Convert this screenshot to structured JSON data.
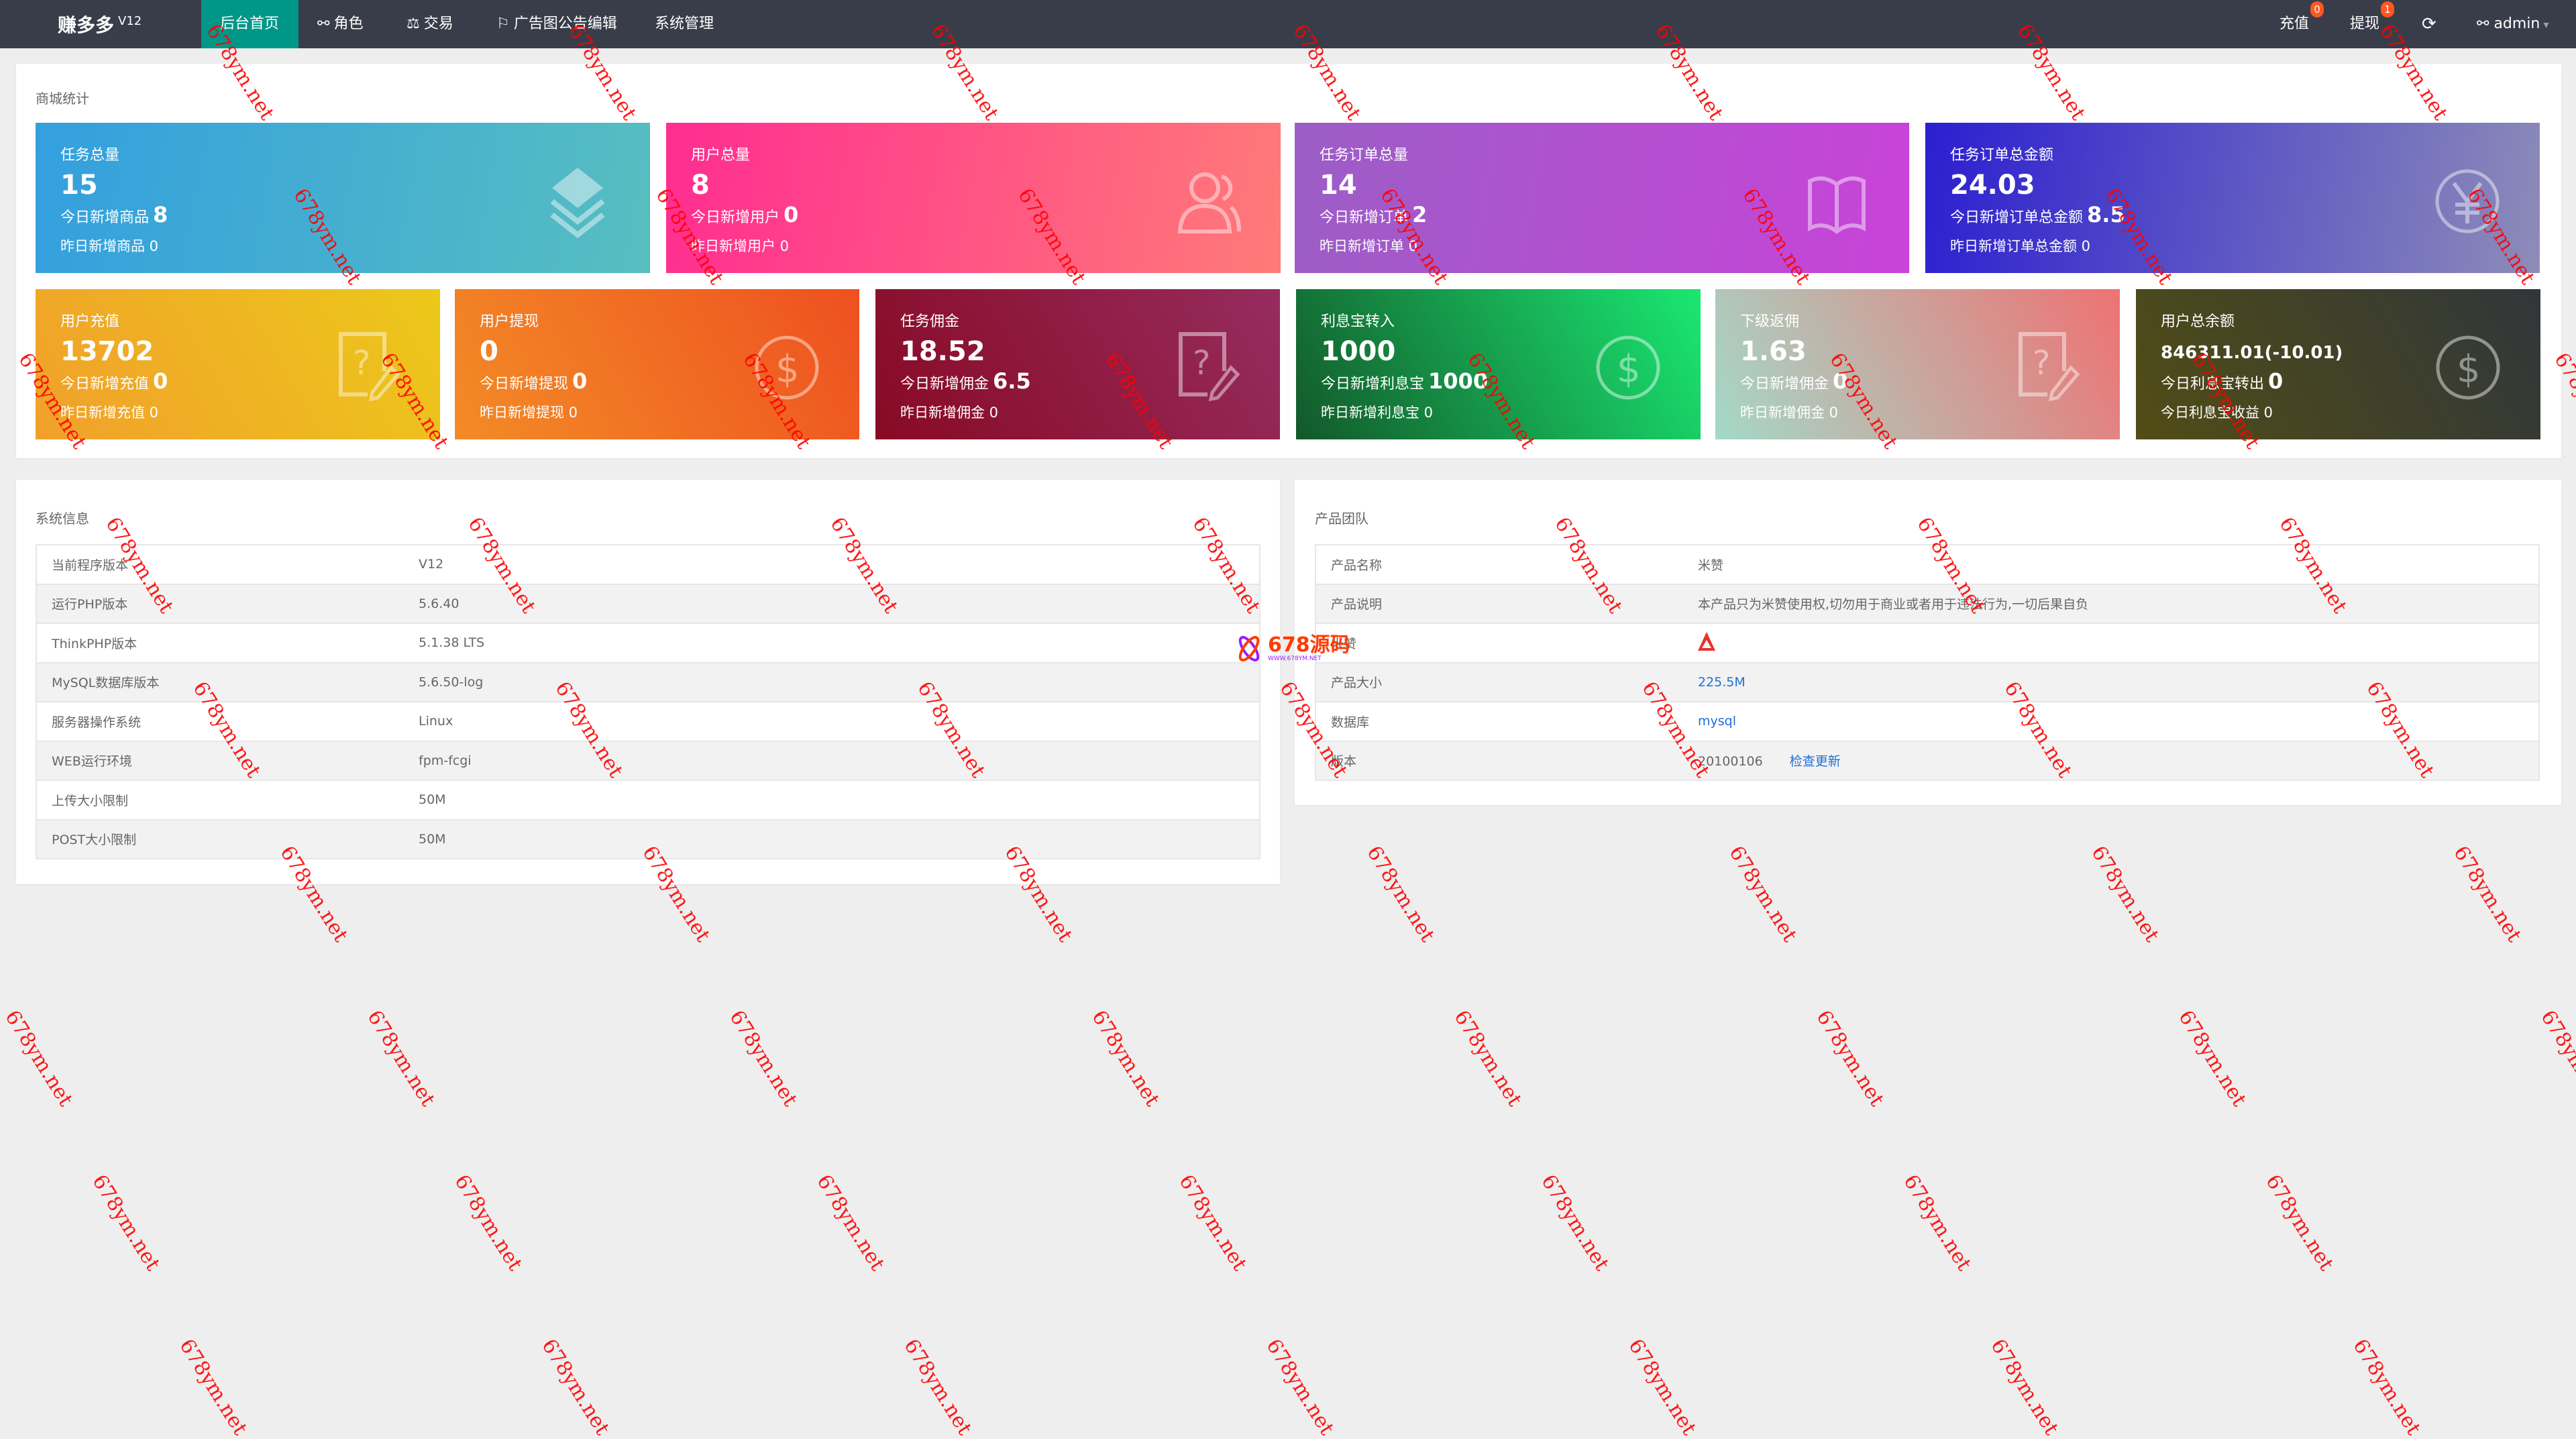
{
  "nav": {
    "logo": "赚多多",
    "version": "V12",
    "items": [
      {
        "label": "后台首页"
      },
      {
        "label": "角色"
      },
      {
        "label": "交易"
      },
      {
        "label": "广告图公告编辑"
      },
      {
        "label": "系统管理"
      }
    ],
    "recharge": "充值",
    "recharge_badge": "0",
    "withdraw": "提现",
    "withdraw_badge": "1",
    "user": "admin",
    "active_color": "#009688",
    "badge_color": "#ff5722"
  },
  "stats": {
    "title": "商城统计",
    "row1": [
      {
        "title": "任务总量",
        "value": "15",
        "l1": "今日新增商品",
        "l1v": "8",
        "l2": "昨日新增商品 0",
        "icon": "layers-icon"
      },
      {
        "title": "用户总量",
        "value": "8",
        "l1": "今日新增用户",
        "l1v": "0",
        "l2": "昨日新增用户 0",
        "icon": "users-icon"
      },
      {
        "title": "任务订单总量",
        "value": "14",
        "l1": "今日新增订单",
        "l1v": "2",
        "l2": "昨日新增订单 0",
        "icon": "book-icon"
      },
      {
        "title": "任务订单总金额",
        "value": "24.03",
        "l1": "今日新增订单总金额",
        "l1v": "8.5",
        "l2": "昨日新增订单总金额 0",
        "icon": "yen-icon"
      }
    ],
    "row2": [
      {
        "title": "用户充值",
        "value": "13702",
        "l1": "今日新增充值",
        "l1v": "0",
        "l2": "昨日新增充值 0",
        "icon": "help-edit-icon"
      },
      {
        "title": "用户提现",
        "value": "0",
        "l1": "今日新增提现",
        "l1v": "0",
        "l2": "昨日新增提现 0",
        "icon": "dollar-icon"
      },
      {
        "title": "任务佣金",
        "value": "18.52",
        "l1": "今日新增佣金",
        "l1v": "6.5",
        "l2": "昨日新增佣金 0",
        "icon": "help-edit-icon"
      },
      {
        "title": "利息宝转入",
        "value": "1000",
        "l1": "今日新增利息宝",
        "l1v": "1000",
        "l2": "昨日新增利息宝 0",
        "icon": "dollar-icon"
      },
      {
        "title": "下级返佣",
        "value": "1.63",
        "l1": "今日新增佣金",
        "l1v": "0",
        "l2": "昨日新增佣金 0",
        "icon": "help-edit-icon"
      },
      {
        "title": "用户总余额",
        "value": "846311.01(-10.01)",
        "l1": "今日利息宝转出",
        "l1v": "0",
        "l2": "今日利息宝收益 0",
        "icon": "dollar-icon"
      }
    ]
  },
  "sysinfo": {
    "title": "系统信息",
    "rows": [
      [
        "当前程序版本",
        "V12"
      ],
      [
        "运行PHP版本",
        "5.6.40"
      ],
      [
        "ThinkPHP版本",
        "5.1.38 LTS"
      ],
      [
        "MySQL数据库版本",
        "5.6.50-log"
      ],
      [
        "服务器操作系统",
        "Linux"
      ],
      [
        "WEB运行环境",
        "fpm-fcgi"
      ],
      [
        "上传大小限制",
        "50M"
      ],
      [
        "POST大小限制",
        "50M"
      ]
    ]
  },
  "team": {
    "title": "产品团队",
    "rows": [
      {
        "k": "产品名称",
        "v": "米赞"
      },
      {
        "k": "产品说明",
        "v": "本产品只为米赞使用权,切勿用于商业或者用于违法行为,一切后果自负"
      },
      {
        "k": "米赞",
        "v": ""
      },
      {
        "k": "产品大小",
        "v": "225.5M"
      },
      {
        "k": "数据库",
        "v": "mysql"
      },
      {
        "k": "版本",
        "v": "20100106",
        "link": "检查更新"
      }
    ]
  },
  "watermark": "678ym.net",
  "brand_logo": {
    "text": "678源码",
    "url": "WWW.678YM.NET"
  }
}
